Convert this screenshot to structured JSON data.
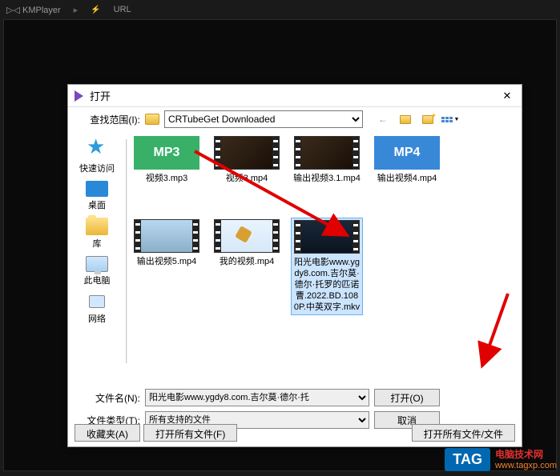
{
  "app": {
    "name": "KMPlayer",
    "menu_url": "URL"
  },
  "dialog": {
    "title": "打开",
    "lookup_label": "查找范围(I):",
    "lookup_value": "CRTubeGet Downloaded",
    "filename_label": "文件名(N):",
    "filename_value": "阳光电影www.ygdy8.com.吉尔莫·德尔·托",
    "filetype_label": "文件类型(T):",
    "filetype_value": "所有支持的文件",
    "open_btn": "打开(O)",
    "cancel_btn": "取消",
    "fav_btn": "收藏夹(A)",
    "openall_btn": "打开所有文件(F)",
    "openall_folder_btn": "打开所有文件/文件"
  },
  "sidebar": {
    "quick": "快速访问",
    "desktop": "桌面",
    "library": "库",
    "thispc": "此电脑",
    "network": "网络"
  },
  "files": {
    "mp3_badge": "MP3",
    "mp4_badge": "MP4",
    "f1": "视频3.mp3",
    "f2": "视频3.mp4",
    "f3": "输出视频3.1.mp4",
    "f4": "输出视频4.mp4",
    "f5": "输出视频5.mp4",
    "f6": "我的视频.mp4",
    "f7": "阳光电影www.ygdy8.com.吉尔莫·德尔·托罗的匹诺曹.2022.BD.1080P.中英双字.mkv"
  },
  "watermark": {
    "tag": "TAG",
    "line1": "电脑技术网",
    "line2": "www.tagxp.com"
  }
}
